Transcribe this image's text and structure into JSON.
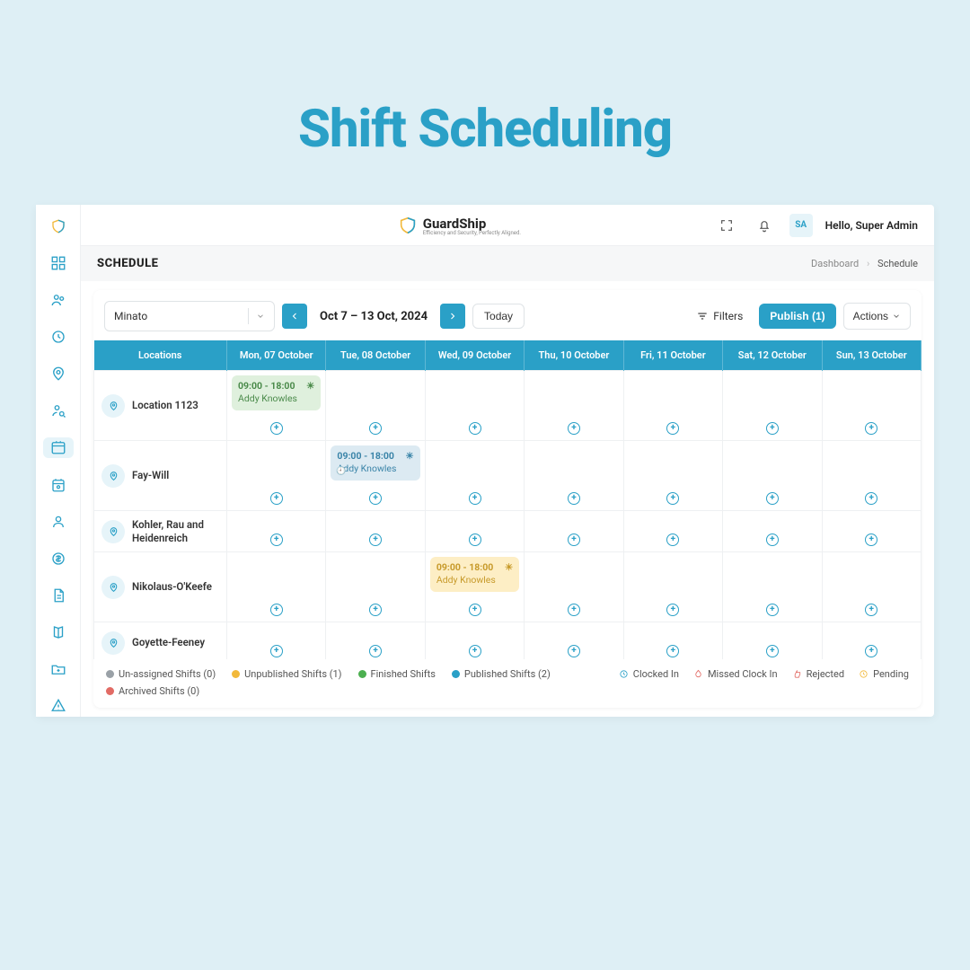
{
  "hero": {
    "title": "Shift Scheduling"
  },
  "brand": {
    "name": "GuardShip",
    "tagline": "Efficiency and Security, Perfectly Aligned."
  },
  "topbar": {
    "avatar_initials": "SA",
    "greeting": "Hello, Super Admin"
  },
  "subheader": {
    "title": "SCHEDULE"
  },
  "breadcrumb": {
    "root": "Dashboard",
    "current": "Schedule"
  },
  "toolbar": {
    "location_select": "Minato",
    "date_range": "Oct 7 – 13 Oct, 2024",
    "today_label": "Today",
    "filters_label": "Filters",
    "publish_label": "Publish (1)",
    "actions_label": "Actions"
  },
  "columns": {
    "locations": "Locations",
    "d0": "Mon, 07 October",
    "d1": "Tue, 08 October",
    "d2": "Wed, 09 October",
    "d3": "Thu, 10 October",
    "d4": "Fri, 11 October",
    "d5": "Sat, 12 October",
    "d6": "Sun, 13 October"
  },
  "rows": [
    {
      "name": "Location 1123"
    },
    {
      "name": "Fay-Will"
    },
    {
      "name": "Kohler, Rau and Heidenreich"
    },
    {
      "name": "Nikolaus-O'Keefe"
    },
    {
      "name": "Goyette-Feeney"
    }
  ],
  "shifts": {
    "r0d0": {
      "time": "09:00 - 18:00",
      "person": "Addy Knowles"
    },
    "r1d1": {
      "time": "09:00 - 18:00",
      "person": "Addy Knowles"
    },
    "r3d2": {
      "time": "09:00 - 18:00",
      "person": "Addy Knowles"
    }
  },
  "legend": {
    "unassigned": "Un-assigned Shifts (0)",
    "unpublished": "Unpublished Shifts (1)",
    "finished": "Finished Shifts",
    "published": "Published Shifts (2)",
    "clocked_in": "Clocked In",
    "missed": "Missed Clock In",
    "rejected": "Rejected",
    "pending": "Pending",
    "archived": "Archived Shifts (0)"
  }
}
